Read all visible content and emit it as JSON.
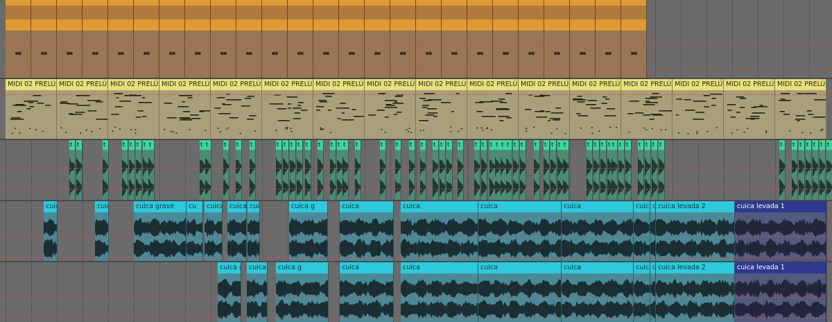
{
  "arrangement": {
    "tracks": [
      {
        "id": "drums",
        "color": "#e09a35",
        "clip_name": "",
        "clip_count": 25,
        "note_glyph": "▪▪"
      },
      {
        "id": "midi",
        "color": "#e8e07c",
        "clip_name": "MIDI 02 PRELÚDIO",
        "clip_count": 16
      },
      {
        "id": "green-perc",
        "color": "#3ed69a",
        "clip_label": "t"
      },
      {
        "id": "cuica-1",
        "color": "#2ec9dc",
        "clips": [
          "cuíca",
          "cuíca",
          "cuíca grave",
          "cuíca grave",
          "cuíca",
          "cuíca",
          "cuíca",
          "cuíca g",
          "cuíca",
          "cuíca",
          "cuíca",
          "cuíca",
          "cuíca",
          "cuíca",
          "cuíca levada 2",
          "cuica levada 1"
        ]
      },
      {
        "id": "cuica-2",
        "color": "#2ec9dc",
        "clips": [
          "cuica g",
          "cuíca",
          "cuíca",
          "cuíca",
          "cuica g",
          "cuíca",
          "cuíca",
          "cuíca",
          "cuíca",
          "cuíca levada 2",
          "cuica levada 1"
        ]
      }
    ]
  },
  "labels": {
    "midi_clip": "MIDI 02 PRELÚDIO",
    "cuica": "cuica",
    "cuica_short": "cu",
    "cuica_g": "cuica g",
    "cuica_grave": "cuica grave",
    "cuica_levada_2": "cuica levada 2",
    "cuica_levada_1": "cuica levada 1"
  },
  "colors": {
    "orange": "#e09a35",
    "yellow": "#e8e07c",
    "green": "#3ed69a",
    "cyan": "#2ec9dc",
    "navy": "#2d3990",
    "dashed_line": "#e04646"
  }
}
